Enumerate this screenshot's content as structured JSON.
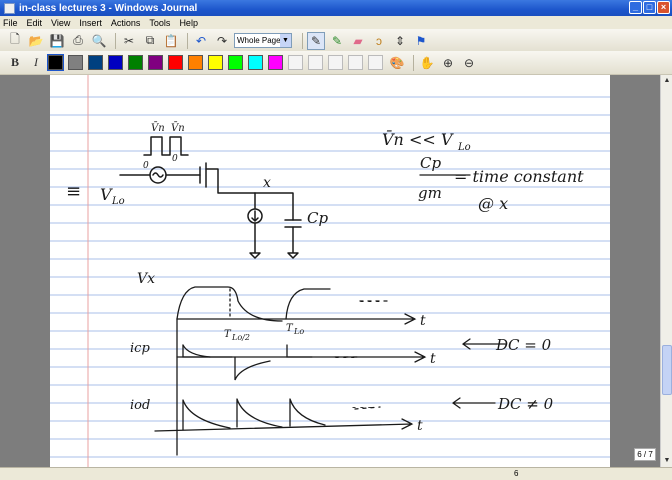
{
  "window": {
    "title": "in-class lectures 3 - Windows Journal"
  },
  "menu": [
    "File",
    "Edit",
    "View",
    "Insert",
    "Actions",
    "Tools",
    "Help"
  ],
  "toolbar": {
    "zoom_value": "Whole Page"
  },
  "palette": [
    "#000000",
    "#808080",
    "#004080",
    "#0000c0",
    "#008000",
    "#800080",
    "#ff0000",
    "#ff8000",
    "#ffff00",
    "#00ff00",
    "#00ffff",
    "#ff00ff"
  ],
  "page": {
    "indicator": "6 / 7",
    "number": "6"
  },
  "notes": {
    "eq_sign": "≡",
    "vlo": "V",
    "vlo_sub": "Lo",
    "vn": "V̄n",
    "cond": "V̄n << V",
    "cond_sub": "Lo",
    "node": "x",
    "cp": "Cp",
    "ratio_num": "Cp",
    "ratio_den": "gm",
    "time_const": "= time constant",
    "at_x": "@ x",
    "vx": "Vx",
    "icp": "icp",
    "iod": "iod",
    "t": "t",
    "tlo2": "T",
    "tlo2_sub": "Lo/2",
    "tlo": "T",
    "tlo_sub": "Lo",
    "dots": "- - -",
    "dc0": "DC = 0",
    "dcnot0": "DC ≠ 0",
    "zero": "0"
  }
}
